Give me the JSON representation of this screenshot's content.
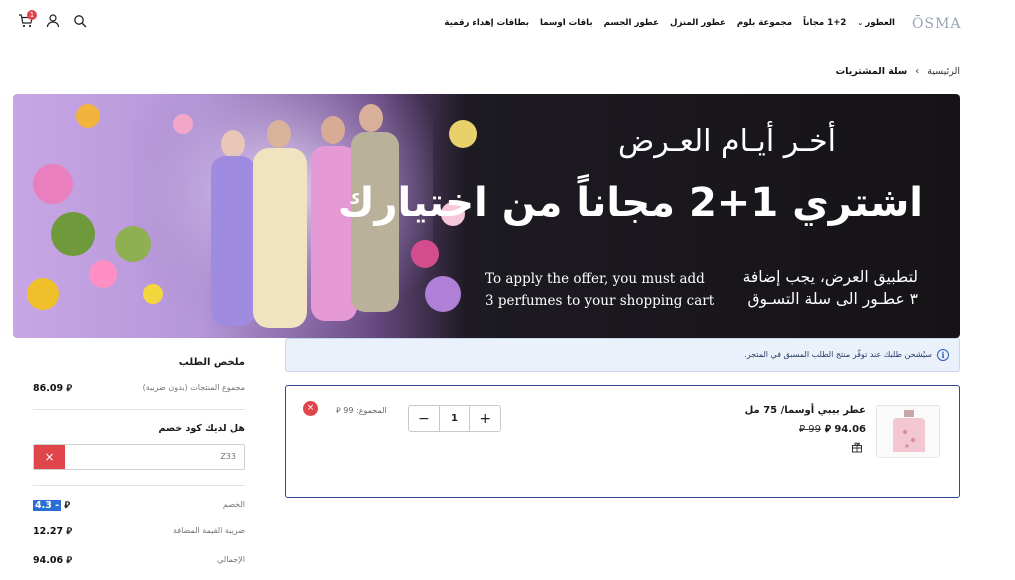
{
  "header": {
    "logo": "ŌSMA",
    "nav": [
      "العطور",
      "1+2 مجاناً",
      "مجموعة بلوم",
      "عطور المنزل",
      "عطور الجسم",
      "باقات اوسما",
      "بطاقات إهداء رقمية"
    ],
    "cart_count": "1",
    "icons": [
      "cart-icon",
      "user-icon",
      "search-icon"
    ]
  },
  "breadcrumb": {
    "home": "الرئيسية",
    "separator": "›",
    "current": "سلة المشتريات"
  },
  "banner": {
    "line1": "أخـر أيـام العـرض",
    "line2": "اشتري 1+2 مجاناً من اختيارك",
    "arabic_note_1": "لتطبيق العرض، يجب إضافة",
    "arabic_note_2": "٣ عطـور الى سلة التسـوق",
    "english_note_1": "To apply the offer, you must add",
    "english_note_2": "3 perfumes to your shopping cart"
  },
  "info_bar": {
    "text": "سيُشحن طلبك عند توفّر منتج الطلب المسبق في المتجر.",
    "icon": "i"
  },
  "cart_item": {
    "name": "عطر بيبي أوسما/ 75 مل",
    "old_price": "99 ⃁",
    "new_price": "94.06 ⃁",
    "quantity": "1",
    "minus": "−",
    "plus": "+",
    "subtotal": "المجموع: 99 ⃁",
    "remove": "×"
  },
  "summary": {
    "title": "ملخص الطلب",
    "products_total_label": "مجموع المنتجات (بدون ضريبة)",
    "products_total_value": "86.09 ⃁",
    "coupon_title": "هل لديك كود خصم",
    "coupon_value": "Z33",
    "coupon_clear": "×",
    "discount_label": "الخصم",
    "discount_value": "4.3 -",
    "vat_label": "ضريبة القيمة المضافة",
    "vat_value": "12.27 ⃁",
    "total_label": "الإجمالي",
    "total_value": "94.06 ⃁"
  },
  "colors": {
    "accent_red": "#e0454c",
    "accent_blue": "#2d4b8c",
    "info_bg": "#eaf1fb"
  }
}
